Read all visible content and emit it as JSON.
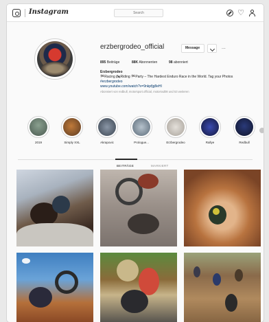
{
  "header": {
    "logo_text": "Instagram",
    "search_placeholder": "Search",
    "icons": [
      "instagram-glyph-icon",
      "compass-icon",
      "heart-icon",
      "person-icon"
    ]
  },
  "profile": {
    "username": "erzbergrodeo_official",
    "message_label": "Message",
    "more_label": "...",
    "stats": {
      "posts": {
        "count": "895",
        "label": "Beiträge"
      },
      "followers": {
        "count": "88K",
        "label": "Abonnenten"
      },
      "following": {
        "count": "98",
        "label": "abonniert"
      }
    },
    "bio_name": "Erzbergrodeo",
    "bio_line1": "🏁Racing 🏍Riding 🏁Party – The Hardest Enduro Race in the World. Tag your Photos",
    "bio_line2": "#erzbergrodeo",
    "bio_line3": "www.youtube.com/watch?v=9nkpfjg8eHI",
    "followed_by": "Abonniert von redbull, motorsport.official, motorrad08 und 53 weiteren"
  },
  "highlights": [
    {
      "label": "2019",
      "color": "#6f8a7a"
    },
    {
      "label": "Simply XXL",
      "color": "#8a5a3a"
    },
    {
      "label": "Akrapovic",
      "color": "#556070"
    },
    {
      "label": "Prologue...",
      "color": "#7a8a9a"
    },
    {
      "label": "Erzbergrodeo",
      "color": "#c7c2bb"
    },
    {
      "label": "Rallye",
      "color": "#1f2a6a"
    },
    {
      "label": "Redbull",
      "color": "#1e2440"
    }
  ],
  "tabs": {
    "posts": "BEITRÄGE",
    "tagged": "MARKIERT"
  }
}
